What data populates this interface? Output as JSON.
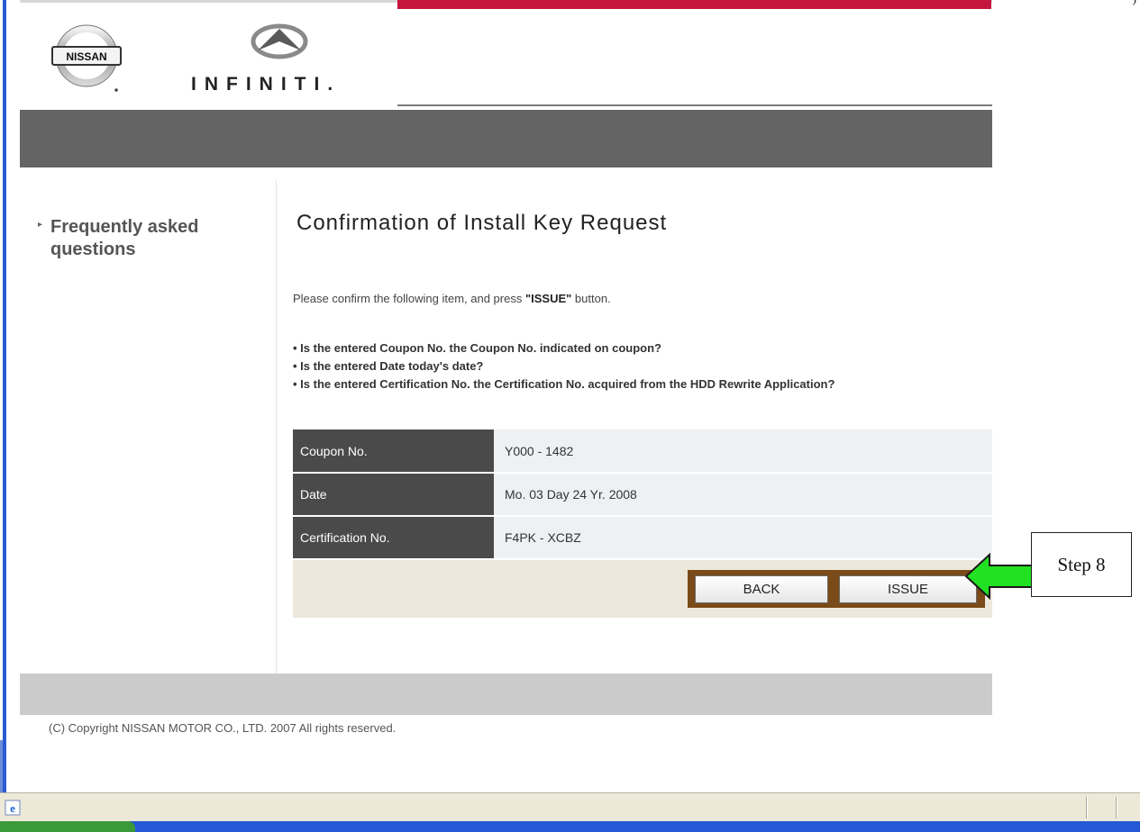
{
  "top_right_text": ")",
  "header": {
    "nissan_logo_text": "NISSAN",
    "infiniti_logo_text": "INFINITI."
  },
  "sidebar": {
    "faq_label": "Frequently asked questions"
  },
  "main": {
    "title": "Confirmation of Install Key Request",
    "intro_prefix": "Please confirm the following item, and press ",
    "intro_bold": "\"ISSUE\"",
    "intro_suffix": " button.",
    "checks": [
      "• Is the entered Coupon No. the Coupon No. indicated on coupon?",
      "• Is the entered Date today's date?",
      "• Is the entered Certification No. the Certification No. acquired from the HDD Rewrite Application?"
    ],
    "rows": [
      {
        "label": "Coupon No.",
        "value": "Y000 - 1482"
      },
      {
        "label": "Date",
        "value": "Mo. 03 Day 24 Yr. 2008"
      },
      {
        "label": "Certification No.",
        "value": "F4PK - XCBZ"
      }
    ],
    "back_button": "BACK",
    "issue_button": "ISSUE"
  },
  "footer": {
    "copyright": "(C) Copyright NISSAN MOTOR CO., LTD. 2007 All rights reserved."
  },
  "annotation": {
    "step_label": "Step 8",
    "arrow_color": "#22e022"
  },
  "colors": {
    "brand_red": "#c4163e",
    "band_dark": "#646464",
    "table_label_bg": "#4a4a4a",
    "button_frame": "#7a4a18"
  }
}
